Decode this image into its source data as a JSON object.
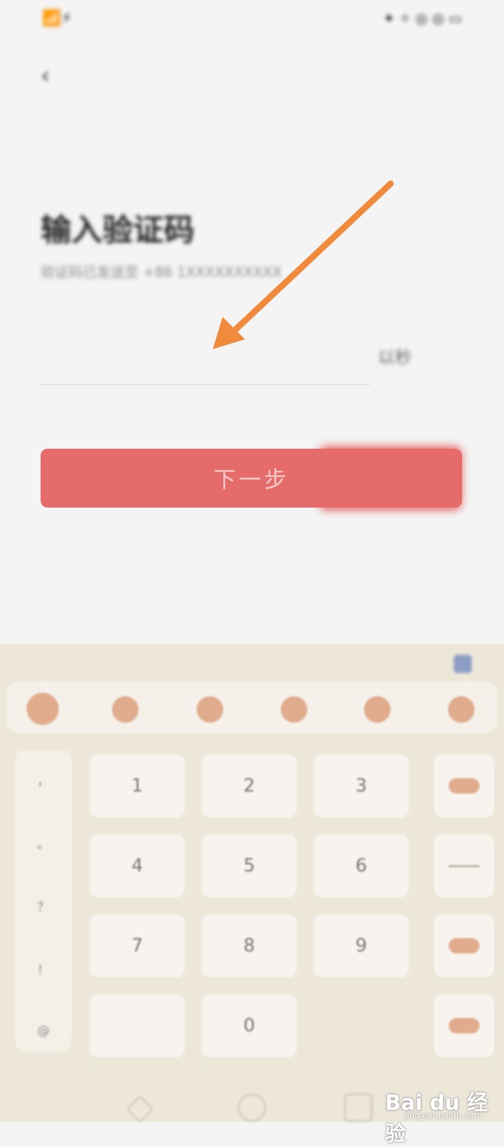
{
  "status_bar": {
    "left": "📶⚡",
    "right": "✦ ✧ ◎ ◎ ▭"
  },
  "header": {
    "back": "‹"
  },
  "main": {
    "title": "输入验证码",
    "subtitle": "验证码已发送至 +86 1XXXXXXXXXX",
    "input_placeholder": "",
    "resend": "以秒",
    "next_button": "下一步"
  },
  "keyboard": {
    "toolbar_icons": [
      "emoji-icon",
      "keyboard-icon",
      "mic-icon",
      "code-icon",
      "circle-icon",
      "circle-icon"
    ],
    "symbols": [
      "，",
      "。",
      "？",
      "！",
      "@"
    ],
    "keys": [
      "1",
      "2",
      "3",
      "4",
      "5",
      "6",
      "7",
      "8",
      "9",
      "",
      "0"
    ],
    "colors": {
      "accent": "#e0ac8d",
      "button": "#e66c6c",
      "arrow": "#f08a3c"
    }
  },
  "watermark": {
    "brand": "Bai du 经验",
    "site": "jingyan.baidu.com"
  }
}
